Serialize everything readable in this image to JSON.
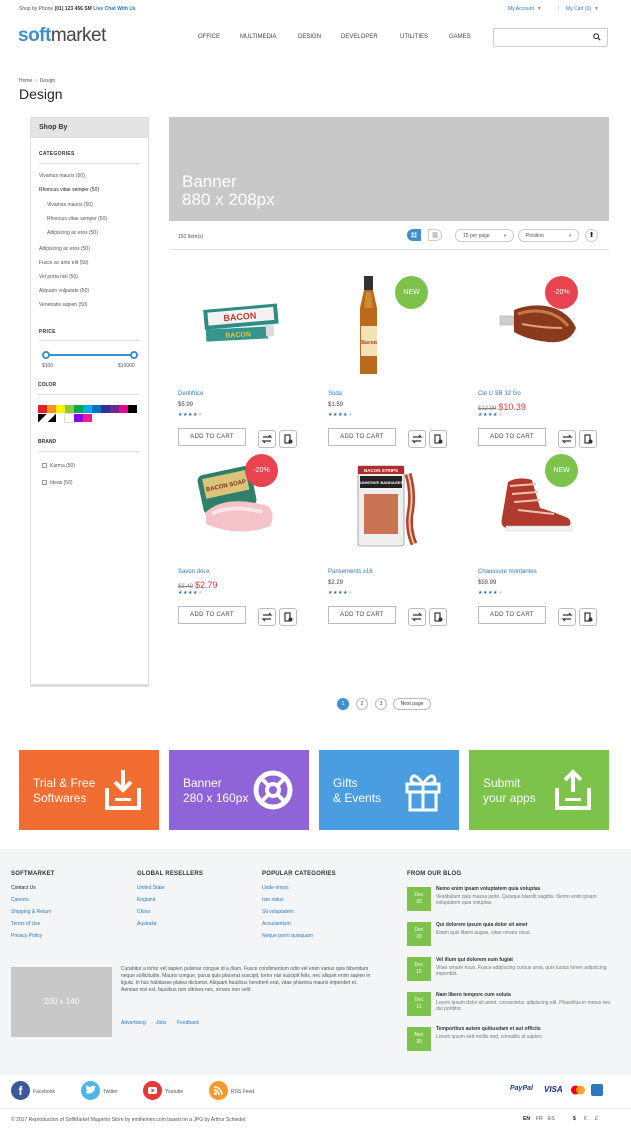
{
  "topbar": {
    "phone_prefix": "Shop by Phone",
    "phone_number": "(01) 123 456 SM",
    "live_chat": "Live Chat With Us",
    "account": "My Account",
    "cart": "My Cart (0)"
  },
  "logo": {
    "soft": "soft",
    "market": "market"
  },
  "nav": [
    "OFFICE",
    "MULTIMEDIA",
    "DESIGN",
    "DEVELOPER",
    "UTILITIES",
    "GAMES"
  ],
  "search": {
    "placeholder": "",
    "value": ""
  },
  "breadcrumb": {
    "home": "Home",
    "separator": "›",
    "current": "Design"
  },
  "page_title": "Design",
  "sidebar": {
    "title": "Shop By",
    "categories_title": "CATEGORIES",
    "categories": [
      "Vivamus mauris (50)",
      "Rhoncus vitae semper (50)",
      "Vivamus mauris (50)",
      "Rhoncus vitae semper (50)",
      "Adipiscing ac eros (50)",
      "Adipiscing ac eros (50)",
      "Fusce ac ante elit (50)",
      "Vel porta nisl (50)",
      "Aliquam vulputate (50)",
      "Venenatis sapien (50)"
    ],
    "price_title": "PRICE",
    "price_min": "$100",
    "price_max": "$10000",
    "color_title": "COLOR",
    "colors": [
      "#e81e25",
      "#f7941d",
      "#fff200",
      "#8dc63f",
      "#00a651",
      "#00aeef",
      "#0072bc",
      "#2e3192",
      "#662d91",
      "#ec008c",
      "#000000",
      "#ffffff",
      "#8b00ff",
      "#ed1c8f"
    ],
    "brand_title": "BRAND",
    "brands": [
      "Karma (50)",
      "Ideas (50)"
    ]
  },
  "banner": {
    "line1": "Banner",
    "line2": "880 x 208px"
  },
  "toolbar": {
    "items_count": "150 Item(s)",
    "per_page": "15 per page",
    "sort": "Position",
    "up_arrow": "⬆"
  },
  "products": [
    {
      "name": "Dentifrice",
      "price": "$5.99",
      "old_price": "",
      "new_price": "",
      "badge": "",
      "rating": 4,
      "add_label": "ADD TO CART"
    },
    {
      "name": "Soda",
      "price": "$1.59",
      "old_price": "",
      "new_price": "",
      "badge": "NEW",
      "rating": 4,
      "add_label": "ADD TO CART"
    },
    {
      "name": "Clé U SB 32 Go",
      "price": "",
      "old_price": "$12.99",
      "new_price": "$10.39",
      "badge": "-20%",
      "rating": 4,
      "add_label": "ADD TO CART"
    },
    {
      "name": "Savon doux",
      "price": "",
      "old_price": "$3.49",
      "new_price": "$2.79",
      "badge": "-20%",
      "rating": 4,
      "add_label": "ADD TO CART"
    },
    {
      "name": "Pansements x16",
      "price": "$2.29",
      "old_price": "",
      "new_price": "",
      "badge": "",
      "rating": 4,
      "add_label": "ADD TO CART"
    },
    {
      "name": "Chaussure montantes",
      "price": "$59.99",
      "old_price": "",
      "new_price": "",
      "badge": "NEW",
      "rating": 4,
      "add_label": "ADD TO CART"
    }
  ],
  "product_art": {
    "toothpaste_text": "BACON",
    "soda_text": "Bacon",
    "tin_text_1": "BACON SOAP",
    "bandage_title": "BACON STRIPS",
    "bandage_sub": "ADHESIVE BANDAGES"
  },
  "pagination": {
    "pages": [
      "1",
      "2",
      "3"
    ],
    "current": "1",
    "next": "Next page"
  },
  "tiles": [
    {
      "line1": "Trial & Free",
      "line2": "Softwares",
      "color": "#f26d31",
      "icon": "download-box-icon"
    },
    {
      "line1": "Banner",
      "line2": "280 x 160px",
      "color": "#8e64d8",
      "icon": "lifebuoy-icon"
    },
    {
      "line1": "Gifts",
      "line2": "& Events",
      "color": "#4a9de0",
      "icon": "gift-icon"
    },
    {
      "line1": "Submit",
      "line2": "your apps",
      "color": "#7cc24b",
      "icon": "upload-box-icon"
    }
  ],
  "footer": {
    "col1_title": "SOFTMARKET",
    "col1_links": [
      "Contact Us",
      "Careers",
      "Shipping & Return",
      "Terms of Use",
      "Privacy Policy"
    ],
    "col2_title": "GLOBAL RESELLERS",
    "col2_links": [
      "United State",
      "England",
      "China",
      "Australia"
    ],
    "col3_title": "POPULAR CATEGORIES",
    "col3_links": [
      "Unde omnis",
      "Iste natus",
      "Sit voluptatem",
      "Accusantium",
      "Neque porro quisquam"
    ],
    "col4_title": "FROM OUR BLOG",
    "blog": [
      {
        "month": "Dec",
        "day": "20",
        "title": "Nemo enim ipsam voluptatem quia voluptas",
        "text": "Vestibulum quis massa justo. Quisque blandit sagittis. Nemo enim ipsam voluptatem quia voluptas"
      },
      {
        "month": "Dec",
        "day": "20",
        "title": "Qui dolorem ipsum quia dolor sit amet",
        "text": "Etiam quis libero augue, vitae ornare risus."
      },
      {
        "month": "Dec",
        "day": "15",
        "title": "Vel illum qui dolorem eum fugiat",
        "text": "Vitae ornare risus. Fusce adipiscing cursus urna, quis luctus lorem adipiscing imperdiet."
      },
      {
        "month": "Dec",
        "day": "11",
        "title": "Nam libero tempore cum soluta",
        "text": "Lorem ipsum dolor sit amet, consectetur adipiscing elit. Phasellus in metus nec dui porttitor."
      },
      {
        "month": "Nov",
        "day": "30",
        "title": "Temporibus autem quibusdam et aut officiis",
        "text": "Lorem ipsum sed mollis sed, convallis at sapien."
      }
    ],
    "placeholder": "200 x 140",
    "about_text": "Curabitur a tortor vel sapien pulvinar congue id a diam. Fusce condimentum odio vel enim varius quis bibendum neque sollicitudin. Mauris congue, purus quis placerat suscipit, tortor nisi suscipit felis, nec aliquet enim sapien in ligula. In hac habitasse platea dictumst. Aliquam faucibus hendrerit erat, vitae pharetra mauris imperdiet et. Aenean nisl est, faucibus non ultrices nec, ornare non velit.",
    "bottom_links": [
      "Advertising",
      "Jobs",
      "Feedback"
    ]
  },
  "social": [
    {
      "label": "Facebook",
      "color": "#3b5998",
      "icon": "facebook-icon"
    },
    {
      "label": "Twitter",
      "color": "#4fb6e7",
      "icon": "twitter-icon"
    },
    {
      "label": "Youtube",
      "color": "#e53935",
      "icon": "youtube-icon"
    },
    {
      "label": "RSS Feed",
      "color": "#f39c2c",
      "icon": "rss-icon"
    }
  ],
  "payments": [
    "PayPal",
    "VISA"
  ],
  "copyright": "© 2017 Reproduction of SoftMarket Magento Store by emthemes.com based on a JPG by Arthur Scheidel.",
  "languages": [
    "EN",
    "FR",
    "ES"
  ],
  "currencies": [
    "$",
    "€",
    "£"
  ]
}
